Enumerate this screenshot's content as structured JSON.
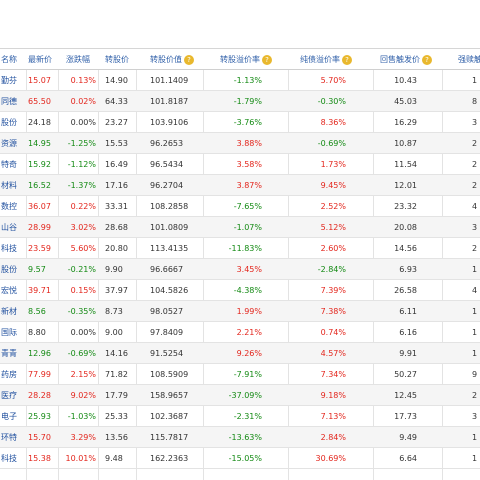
{
  "header": {
    "name": "名称",
    "price": "最新价",
    "change": "涨跌幅",
    "conv_price": "转股价",
    "conv_value": "转股价值",
    "conv_premium": "转股溢价率",
    "bond_premium": "纯债溢价率",
    "putback": "回售触发价",
    "forced": "强赎触"
  },
  "rows": [
    {
      "name": "勤芬",
      "price": "15.07",
      "change": "0.13%",
      "conv_price": "14.90",
      "conv_value": "101.1409",
      "conv_premium": "-1.13%",
      "bond_premium": "5.70%",
      "putback": "10.43",
      "forced": "1"
    },
    {
      "name": "同德",
      "price": "65.50",
      "change": "0.02%",
      "conv_price": "64.33",
      "conv_value": "101.8187",
      "conv_premium": "-1.79%",
      "bond_premium": "-0.30%",
      "putback": "45.03",
      "forced": "8"
    },
    {
      "name": "股份",
      "price": "24.18",
      "change": "0.00%",
      "conv_price": "23.27",
      "conv_value": "103.9106",
      "conv_premium": "-3.76%",
      "bond_premium": "8.36%",
      "putback": "16.29",
      "forced": "3"
    },
    {
      "name": "资源",
      "price": "14.95",
      "change": "-1.25%",
      "conv_price": "15.53",
      "conv_value": "96.2653",
      "conv_premium": "3.88%",
      "bond_premium": "-0.69%",
      "putback": "10.87",
      "forced": "2"
    },
    {
      "name": "特奇",
      "price": "15.92",
      "change": "-1.12%",
      "conv_price": "16.49",
      "conv_value": "96.5434",
      "conv_premium": "3.58%",
      "bond_premium": "1.73%",
      "putback": "11.54",
      "forced": "2"
    },
    {
      "name": "材料",
      "price": "16.52",
      "change": "-1.37%",
      "conv_price": "17.16",
      "conv_value": "96.2704",
      "conv_premium": "3.87%",
      "bond_premium": "9.45%",
      "putback": "12.01",
      "forced": "2"
    },
    {
      "name": "数控",
      "price": "36.07",
      "change": "0.22%",
      "conv_price": "33.31",
      "conv_value": "108.2858",
      "conv_premium": "-7.65%",
      "bond_premium": "2.52%",
      "putback": "23.32",
      "forced": "4"
    },
    {
      "name": "山谷",
      "price": "28.99",
      "change": "3.02%",
      "conv_price": "28.68",
      "conv_value": "101.0809",
      "conv_premium": "-1.07%",
      "bond_premium": "5.12%",
      "putback": "20.08",
      "forced": "3"
    },
    {
      "name": "科技",
      "price": "23.59",
      "change": "5.60%",
      "conv_price": "20.80",
      "conv_value": "113.4135",
      "conv_premium": "-11.83%",
      "bond_premium": "2.60%",
      "putback": "14.56",
      "forced": "2"
    },
    {
      "name": "股份",
      "price": "9.57",
      "change": "-0.21%",
      "conv_price": "9.90",
      "conv_value": "96.6667",
      "conv_premium": "3.45%",
      "bond_premium": "-2.84%",
      "putback": "6.93",
      "forced": "1"
    },
    {
      "name": "宏悦",
      "price": "39.71",
      "change": "0.15%",
      "conv_price": "37.97",
      "conv_value": "104.5826",
      "conv_premium": "-4.38%",
      "bond_premium": "7.39%",
      "putback": "26.58",
      "forced": "4"
    },
    {
      "name": "新材",
      "price": "8.56",
      "change": "-0.35%",
      "conv_price": "8.73",
      "conv_value": "98.0527",
      "conv_premium": "1.99%",
      "bond_premium": "7.38%",
      "putback": "6.11",
      "forced": "1"
    },
    {
      "name": "国际",
      "price": "8.80",
      "change": "0.00%",
      "conv_price": "9.00",
      "conv_value": "97.8409",
      "conv_premium": "2.21%",
      "bond_premium": "0.74%",
      "putback": "6.16",
      "forced": "1"
    },
    {
      "name": "青青",
      "price": "12.96",
      "change": "-0.69%",
      "conv_price": "14.16",
      "conv_value": "91.5254",
      "conv_premium": "9.26%",
      "bond_premium": "4.57%",
      "putback": "9.91",
      "forced": "1"
    },
    {
      "name": "药房",
      "price": "77.99",
      "change": "2.15%",
      "conv_price": "71.82",
      "conv_value": "108.5909",
      "conv_premium": "-7.91%",
      "bond_premium": "7.34%",
      "putback": "50.27",
      "forced": "9"
    },
    {
      "name": "医疗",
      "price": "28.28",
      "change": "9.02%",
      "conv_price": "17.79",
      "conv_value": "158.9657",
      "conv_premium": "-37.09%",
      "bond_premium": "9.18%",
      "putback": "12.45",
      "forced": "2"
    },
    {
      "name": "电子",
      "price": "25.93",
      "change": "-1.03%",
      "conv_price": "25.33",
      "conv_value": "102.3687",
      "conv_premium": "-2.31%",
      "bond_premium": "7.13%",
      "putback": "17.73",
      "forced": "3"
    },
    {
      "name": "环特",
      "price": "15.70",
      "change": "3.29%",
      "conv_price": "13.56",
      "conv_value": "115.7817",
      "conv_premium": "-13.63%",
      "bond_premium": "2.84%",
      "putback": "9.49",
      "forced": "1"
    },
    {
      "name": "科技",
      "price": "15.38",
      "change": "10.01%",
      "conv_price": "9.48",
      "conv_value": "162.2363",
      "conv_premium": "-15.05%",
      "bond_premium": "30.69%",
      "putback": "6.64",
      "forced": "1"
    }
  ],
  "colors": {
    "up": "#e3261d",
    "down": "#148a14",
    "header_text": "#2f5fa8",
    "name_text": "#1f4f9e",
    "help_badge": "#e9b82d"
  },
  "icons": {
    "help": "question-circle-icon"
  }
}
